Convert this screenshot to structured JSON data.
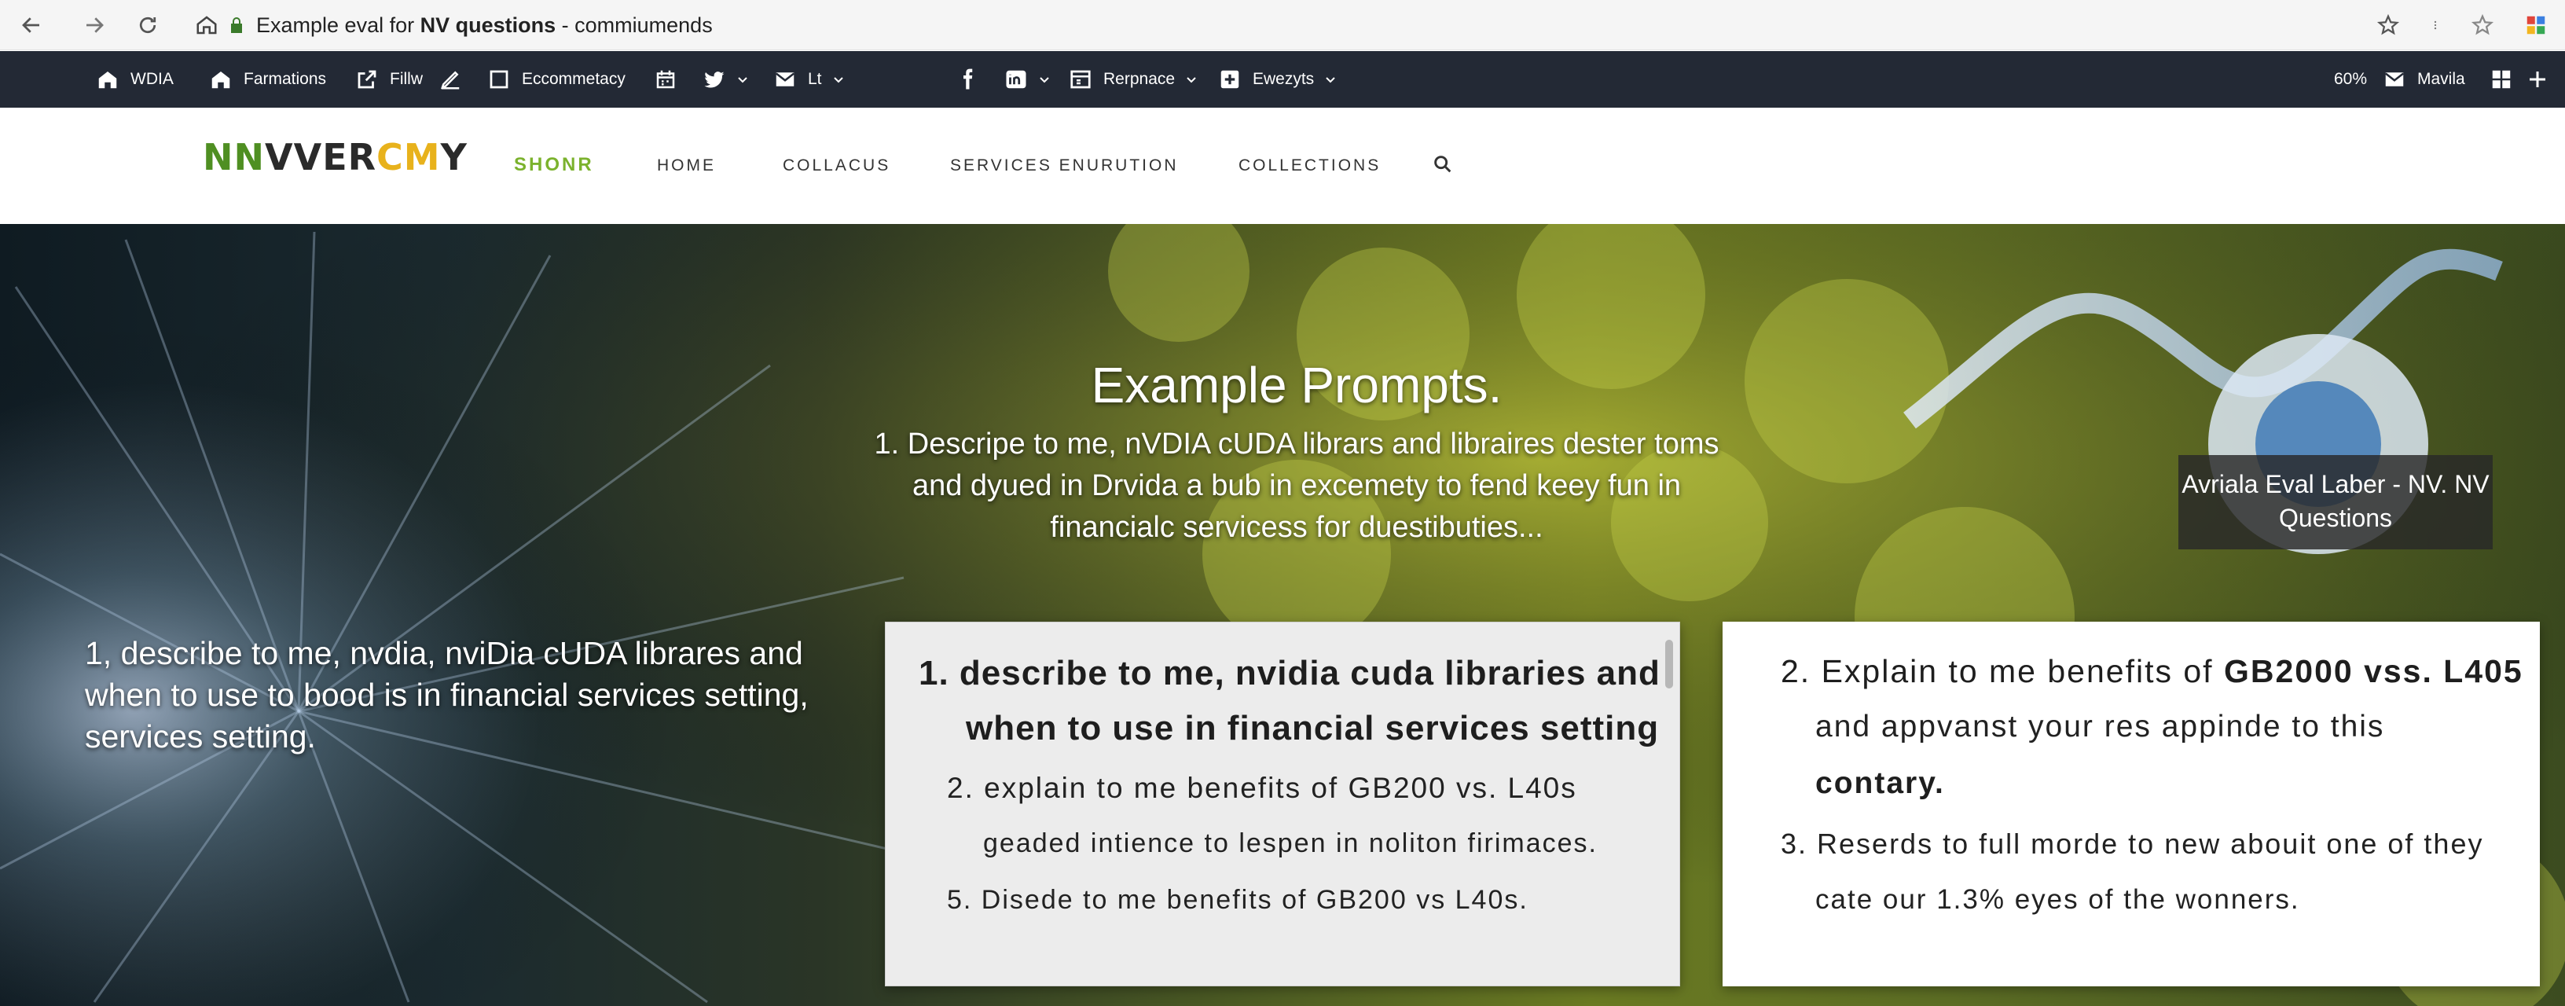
{
  "browser": {
    "url_prefix": "Example eval for",
    "url_bold": "NV questions",
    "url_suffix": "- commiumends"
  },
  "bookmarks": [
    {
      "icon": "home-icon",
      "label": "WDIA"
    },
    {
      "icon": "home-icon",
      "label": "Farmations"
    },
    {
      "icon": "external-link-icon",
      "label": "Fillw"
    },
    {
      "icon": "pen-icon",
      "label": ""
    },
    {
      "icon": "square-icon",
      "label": "Eccommetacy"
    },
    {
      "icon": "calendar-icon",
      "label": ""
    },
    {
      "icon": "twitter-icon",
      "label": ""
    },
    {
      "icon": "mail-icon",
      "label": "Lt"
    },
    {
      "icon": "facebook-icon",
      "label": ""
    },
    {
      "icon": "linkedin-icon",
      "label": ""
    },
    {
      "icon": "window-icon",
      "label": "Rerpnace"
    },
    {
      "icon": "plus-box-icon",
      "label": "Ewezyts"
    }
  ],
  "bookmarks_right": {
    "zoom": "60%",
    "profile_label": "Mavila"
  },
  "site": {
    "logo": {
      "part1": "NN",
      "part2": "VVER",
      "part3": "CM",
      "part4": "Y"
    },
    "nav": [
      "SHONR",
      "HOME",
      "COLLACUS",
      "SERVICES ENURUTION",
      "COLLECTIONS"
    ]
  },
  "hero": {
    "title": "Example Prompts.",
    "desc": "1. Descripe to me, nVDIA cUDA librars and libraires dester toms and dyued in Drvida a bub in excemety to fend keey fun in financialc servicess for duestibuties...",
    "left_lines": [
      "1, describe to me, nvdia, nviDia cUDA librares and",
      "when to use to bood is in financial services setting,",
      "services setting."
    ],
    "badge": "Avriala Eval Laber - NV. NV Questions"
  },
  "card_mid": {
    "line1": "1. describe to me, nvidia cuda libraries and",
    "line2": "when to use in financial services setting",
    "line3": "2. explain to me benefits of GB200 vs. L40s",
    "line4": "geaded intience to lespen in noliton firimaces.",
    "line5": "5. Disede to me benefits of GB200 vs L40s."
  },
  "card_right": {
    "line1_a": "2. Explain to me benefits of",
    "line1_b": "GB2000 vss. L405",
    "line2": "and appvanst your res appinde to this",
    "line3": "contary.",
    "line4": "3. Reserds to full morde to new abouit one of they",
    "line5": "cate our 1.3% eyes of the wonners."
  },
  "colors": {
    "bookmark_bar": "#232935",
    "logo_green": "#4f8f22",
    "logo_yellow": "#e8b21c",
    "nav_active": "#7bb22d"
  }
}
